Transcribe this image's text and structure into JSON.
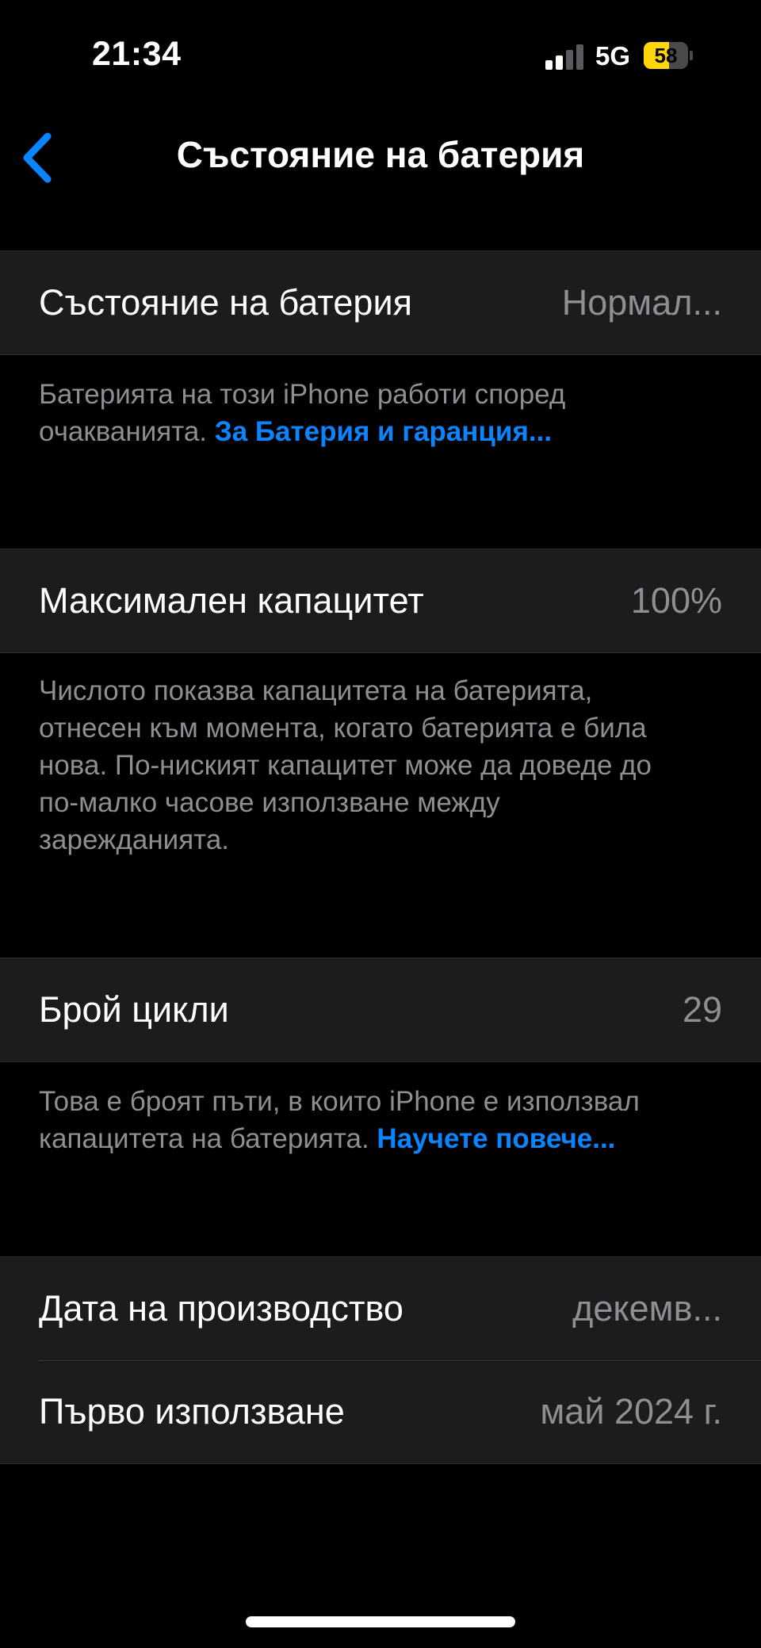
{
  "status_bar": {
    "time": "21:34",
    "network": "5G",
    "battery_level": "58",
    "battery_fraction": 0.58,
    "battery_color": "#ffd60a"
  },
  "nav": {
    "back_icon": "chevron-left-icon",
    "title": "Състояние на батерия",
    "accent_color": "#0a84ff"
  },
  "sections": {
    "health": {
      "label": "Състояние на батерия",
      "value": "Нормал...",
      "footer_text": "Батерията на този iPhone работи според очакванията. ",
      "footer_link": "За Батерия и гаранция..."
    },
    "capacity": {
      "label": "Максимален капацитет",
      "value": "100%",
      "footer_text": "Числото показва капацитета на батерията, отнесен към момента, когато батерията е била нова. По-ниският капацитет може да доведе до по-малко часове използване между зарежданията."
    },
    "cycles": {
      "label": "Брой цикли",
      "value": "29",
      "footer_text": "Това е броят пъти, в които iPhone е използвал капацитета на батерията. ",
      "footer_link": "Научете повече..."
    },
    "dates": {
      "manufacture_label": "Дата на производство",
      "manufacture_value": "декемв...",
      "first_use_label": "Първо използване",
      "first_use_value": "май 2024 г."
    }
  }
}
